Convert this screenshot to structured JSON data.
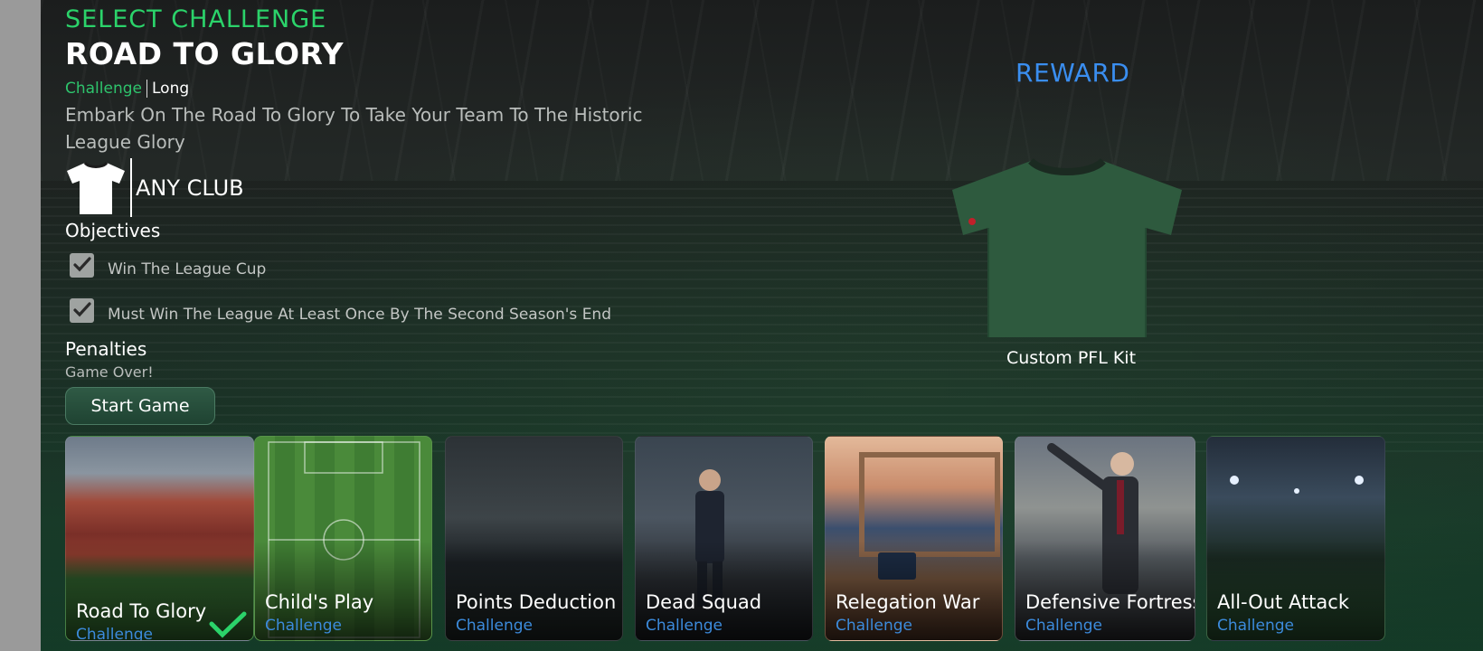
{
  "header": {
    "select_label": "SELECT CHALLENGE",
    "title": "ROAD TO GLORY",
    "type": "Challenge",
    "length": "Long",
    "description": "Embark On The Road To Glory To Take Your Team To The Historic League Glory"
  },
  "club": {
    "icon": "shirt-icon",
    "name": "ANY CLUB"
  },
  "objectives": {
    "heading": "Objectives",
    "items": [
      {
        "label": "Win The League Cup",
        "checked": true
      },
      {
        "label": "Must Win The League At Least Once By The Second Season's End",
        "checked": true
      }
    ]
  },
  "penalties": {
    "heading": "Penalties",
    "text": "Game Over!"
  },
  "start_button": "Start Game",
  "reward": {
    "label": "REWARD",
    "name": "Custom PFL Kit",
    "kit_color": "#2e5a3e"
  },
  "challenges": [
    {
      "name": "Road To Glory",
      "type": "Challenge",
      "selected": true
    },
    {
      "name": "Child's Play",
      "type": "Challenge",
      "selected": false
    },
    {
      "name": "Points Deduction",
      "type": "Challenge",
      "selected": false
    },
    {
      "name": "Dead Squad",
      "type": "Challenge",
      "selected": false
    },
    {
      "name": "Relegation War",
      "type": "Challenge",
      "selected": false
    },
    {
      "name": "Defensive Fortress",
      "type": "Challenge",
      "selected": false
    },
    {
      "name": "All-Out Attack",
      "type": "Challenge",
      "selected": false
    }
  ],
  "colors": {
    "accent_green": "#2bd36a",
    "accent_blue": "#3a8ef0"
  }
}
